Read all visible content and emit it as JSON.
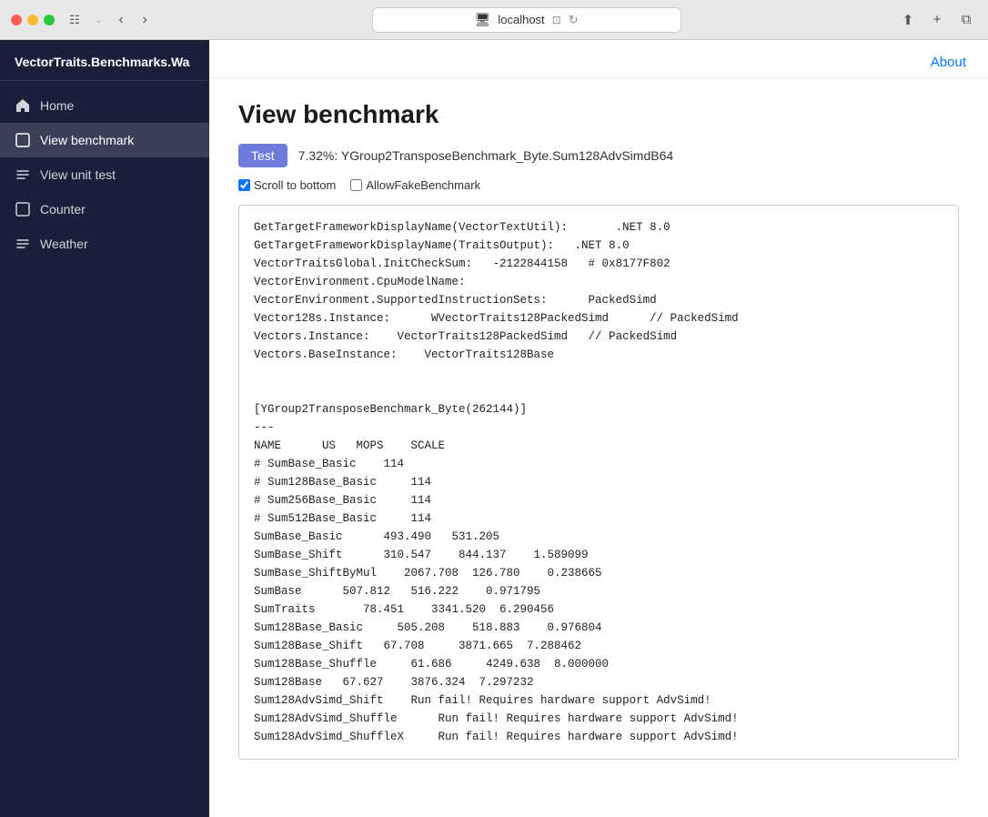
{
  "titlebar": {
    "url": "localhost",
    "traffic_lights": [
      "red",
      "yellow",
      "green"
    ]
  },
  "sidebar": {
    "title": "VectorTraits.Benchmarks.Wa",
    "items": [
      {
        "id": "home",
        "label": "Home",
        "icon": "house",
        "active": false
      },
      {
        "id": "view-benchmark",
        "label": "View benchmark",
        "icon": "plus-square",
        "active": true
      },
      {
        "id": "view-unit-test",
        "label": "View unit test",
        "icon": "lines",
        "active": false
      },
      {
        "id": "counter",
        "label": "Counter",
        "icon": "plus-square",
        "active": false
      },
      {
        "id": "weather",
        "label": "Weather",
        "icon": "lines",
        "active": false
      }
    ]
  },
  "header": {
    "about_label": "About"
  },
  "main": {
    "page_title": "View benchmark",
    "test_button_label": "Test",
    "progress_text": "7.32%: YGroup2TransposeBenchmark_Byte.Sum128AdvSimdB64",
    "scroll_to_bottom_label": "Scroll to bottom",
    "allow_fake_benchmark_label": "AllowFakeBenchmark",
    "scroll_to_bottom_checked": true,
    "allow_fake_benchmark_checked": false,
    "output_lines": [
      "GetTargetFrameworkDisplayName(VectorTextUtil):       .NET 8.0",
      "GetTargetFrameworkDisplayName(TraitsOutput):   .NET 8.0",
      "VectorTraitsGlobal.InitCheckSum:   -2122844158   # 0x8177F802",
      "VectorEnvironment.CpuModelName:",
      "VectorEnvironment.SupportedInstructionSets:      PackedSimd",
      "Vector128s.Instance:      WVectorTraits128PackedSimd      // PackedSimd",
      "Vectors.Instance:    VectorTraits128PackedSimd   // PackedSimd",
      "Vectors.BaseInstance:    VectorTraits128Base",
      "",
      "",
      "[YGroup2TransposeBenchmark_Byte(262144)]",
      "---",
      "NAME      US   MOPS    SCALE",
      "# SumBase_Basic    114",
      "# Sum128Base_Basic     114",
      "# Sum256Base_Basic     114",
      "# Sum512Base_Basic     114",
      "SumBase_Basic      493.490   531.205",
      "SumBase_Shift      310.547    844.137    1.589099",
      "SumBase_ShiftByMul    2067.708  126.780    0.238665",
      "SumBase      507.812   516.222    0.971795",
      "SumTraits       78.451    3341.520  6.290456",
      "Sum128Base_Basic     505.208    518.883    0.976804",
      "Sum128Base_Shift   67.708     3871.665  7.288462",
      "Sum128Base_Shuffle     61.686     4249.638  8.000000",
      "Sum128Base   67.627    3876.324  7.297232",
      "Sum128AdvSimd_Shift    Run fail! Requires hardware support AdvSimd!",
      "Sum128AdvSimd_Shuffle      Run fail! Requires hardware support AdvSimd!",
      "Sum128AdvSimd_ShuffleX     Run fail! Requires hardware support AdvSimd!"
    ]
  }
}
